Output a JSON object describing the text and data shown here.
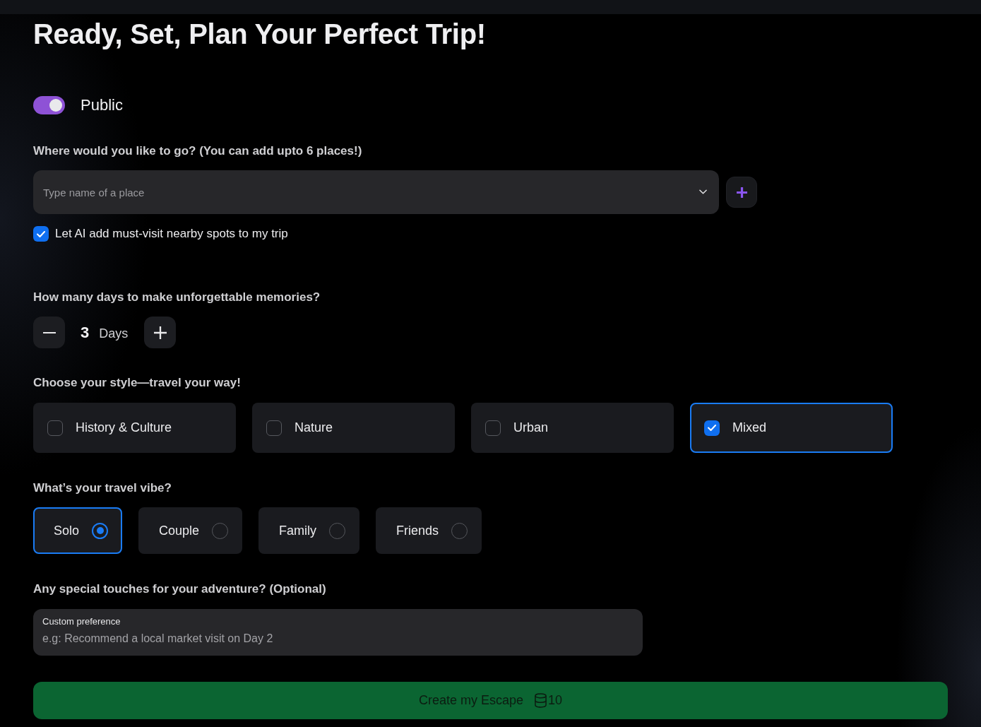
{
  "title": "Ready, Set, Plan Your Perfect Trip!",
  "visibility_toggle": {
    "label": "Public",
    "on": true
  },
  "destinations": {
    "label": "Where would you like to go? (You can add upto 6 places!)",
    "placeholder": "Type name of a place",
    "ai_suggestions": {
      "label": "Let AI add must-visit nearby spots to my trip",
      "checked": true
    }
  },
  "days": {
    "label": "How many days to make unforgettable memories?",
    "value": "3",
    "unit": "Days"
  },
  "styles": {
    "label": "Choose your style—travel your way!",
    "options": [
      {
        "label": "History & Culture",
        "checked": false
      },
      {
        "label": "Nature",
        "checked": false
      },
      {
        "label": "Urban",
        "checked": false
      },
      {
        "label": "Mixed",
        "checked": true
      }
    ]
  },
  "vibes": {
    "label": "What’s your travel vibe?",
    "options": [
      {
        "label": "Solo",
        "selected": true
      },
      {
        "label": "Couple",
        "selected": false
      },
      {
        "label": "Family",
        "selected": false
      },
      {
        "label": "Friends",
        "selected": false
      }
    ]
  },
  "preferences": {
    "label": "Any special touches for your adventure? (Optional)",
    "field_label": "Custom preference",
    "placeholder": "e.g: Recommend a local market visit on Day 2"
  },
  "submit_button": {
    "label": "Create my Escape",
    "cost": "10"
  }
}
